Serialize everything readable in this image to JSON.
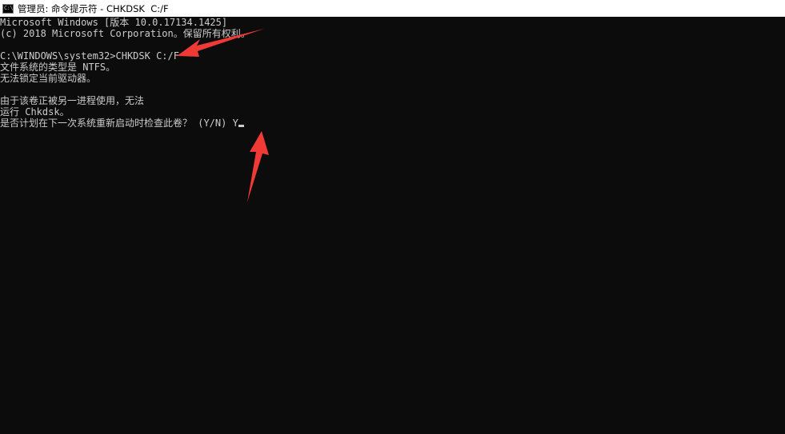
{
  "window": {
    "icon": "console-icon",
    "title": "管理员: 命令提示符 - CHKDSK  C:/F"
  },
  "console": {
    "lines": [
      "Microsoft Windows [版本 10.0.17134.1425]",
      "(c) 2018 Microsoft Corporation。保留所有权利。",
      "",
      "C:\\WINDOWS\\system32>CHKDSK C:/F",
      "文件系统的类型是 NTFS。",
      "无法锁定当前驱动器。",
      "",
      "由于该卷正被另一进程使用，无法",
      "运行 Chkdsk。",
      "是否计划在下一次系统重新启动时检查此卷？ (Y/N) Y"
    ]
  },
  "annotations": {
    "arrow_color": "#f03a36"
  }
}
